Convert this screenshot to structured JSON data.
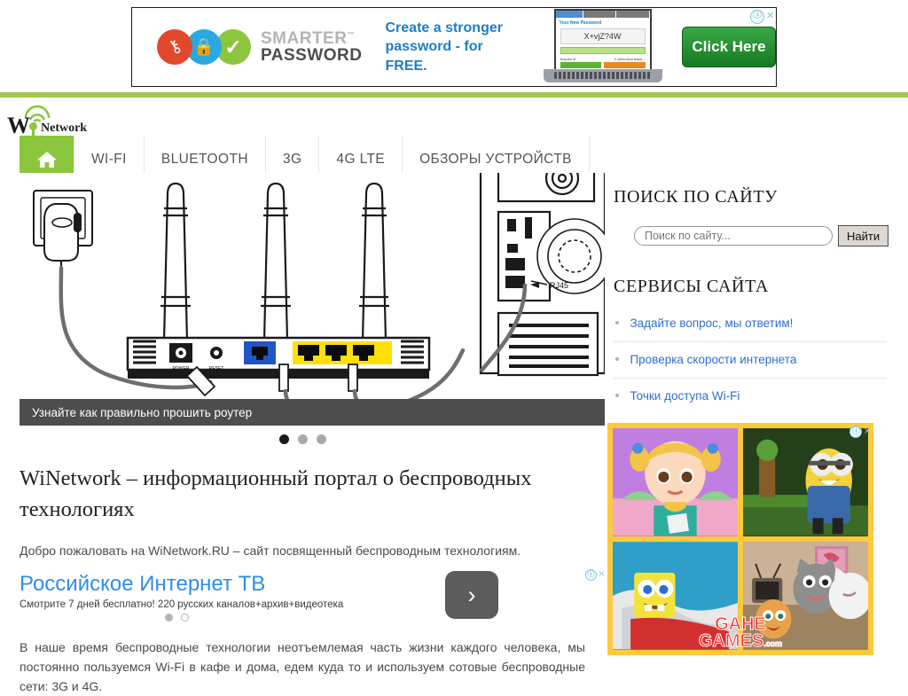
{
  "top_ad": {
    "brand_line1": "SMARTER",
    "brand_line1_tm": "™",
    "brand_line2": "PASSWORD",
    "headline_line1": "Create a stronger",
    "headline_line2": "password - for FREE.",
    "screen_label": "Your New Password",
    "screen_password": "X+vjZ?4W",
    "screen_btn_left": "Acquire it!",
    "screen_btn_right": "It periodical black...",
    "cta_label": "Click Here",
    "adchoices_info": "ⓘ",
    "adchoices_close": "×",
    "icons": {
      "key": "key-icon",
      "lock": "lock-icon",
      "check": "check-icon"
    }
  },
  "header": {
    "logo_w": "W",
    "logo_network": "Network",
    "logo_alt": "WiNetwork"
  },
  "nav": {
    "home_icon": "home-icon",
    "items": [
      {
        "label": "WI-FI"
      },
      {
        "label": "BLUETOOTH"
      },
      {
        "label": "3G"
      },
      {
        "label": "4G LTE"
      },
      {
        "label": "ОБЗОРЫ УСТРОЙСТВ"
      }
    ]
  },
  "slider": {
    "caption": "Узнайте как правильно прошить роутер",
    "image_alt": "Схема подключения роутера к компьютеру",
    "port_label": "RJ45",
    "router_labels": {
      "power": "POWER",
      "reset": "RESET"
    },
    "dots": [
      {
        "active": true
      },
      {
        "active": false
      },
      {
        "active": false
      }
    ]
  },
  "article": {
    "title": "WiNetwork – информационный портал о беспроводных технологиях",
    "lead": "Добро пожаловать на WiNetwork.RU – сайт посвященный беспроводным технологиям.",
    "body": "В наше время беспроводные технологии неотъемлемая часть жизни каждого человека, мы постоянно пользуемся Wi-Fi в кафе и дома, едем куда то и используем сотовые беспроводные сети: 3G и 4G."
  },
  "inline_ad": {
    "title": "Российское Интернет ТВ",
    "subtitle": "Смотрите 7 дней бесплатно! 220 русских каналов+архив+видеотека",
    "arrow_icon": "chevron-right-icon",
    "adchoices_info": "ⓘ",
    "adchoices_close": "×",
    "dots": [
      {
        "active": true
      },
      {
        "active": false
      }
    ]
  },
  "sidebar": {
    "search_heading": "ПОИСК ПО САЙТУ",
    "search_placeholder": "Поиск по сайту...",
    "search_value": "",
    "search_button": "Найти",
    "services_heading": "СЕРВИСЫ САЙТА",
    "services": [
      {
        "label": "Задайте вопрос, мы ответим!"
      },
      {
        "label": "Проверка скорости интернета"
      },
      {
        "label": "Точки доступа Wi-Fi"
      }
    ],
    "games_ad": {
      "brand_line1": "GAHE",
      "brand_line2": "GAMES",
      "brand_suffix": ".com",
      "adchoices_info": "ⓘ",
      "adchoices_close": "×",
      "tiles": [
        {
          "alt": "Baby Hazel game"
        },
        {
          "alt": "Minion run game"
        },
        {
          "alt": "SpongeBob boat game"
        },
        {
          "alt": "Talking Tom cats game"
        }
      ]
    }
  },
  "colors": {
    "brand_green": "#8cc63e",
    "rule_green": "#a3c653",
    "link_blue": "#2f6fd0",
    "ad_blue": "#2f8ee8",
    "caption_gray": "#4d4d4d",
    "games_yellow": "#ffc93c"
  }
}
